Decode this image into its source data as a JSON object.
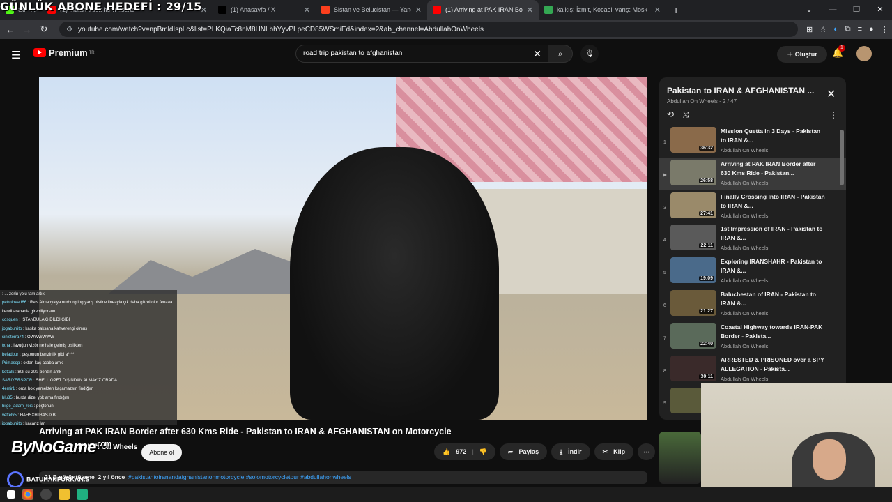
{
  "overlay": {
    "abone": "GÜNLÜK ABONE HEDEFİ : 29/15",
    "bynogame": "ByNoGame",
    "bynogame_sup": ".com",
    "batuhan": "BATUHANFURKAN.S"
  },
  "browser": {
    "tabs": [
      {
        "label": "Stream - Kick Dashboard",
        "fav": "#53fc18"
      },
      {
        "label": "(1) Indian truck horn #sorts",
        "fav": "#ff0000"
      },
      {
        "label": "(1) Anasayfa / X",
        "fav": "#000000"
      },
      {
        "label": "Sistan ve Belucistan — Yandex",
        "fav": "#fc3f1d"
      },
      {
        "label": "(1) Arriving at PAK IRAN Bo",
        "fav": "#ff0000",
        "active": true
      },
      {
        "label": "kalkış: İzmit, Kocaeli varış: Mosk",
        "fav": "#34a853"
      }
    ],
    "new_tab": "+",
    "url": "youtube.com/watch?v=npBmldIspLc&list=PLKQiaTc8nM8HNLbhYyvPLpeCD85WSmiEd&index=2&ab_channel=AbdullahOnWheels"
  },
  "yt": {
    "premium": "Premium",
    "region": "TR",
    "search_query": "road trip pakistan to afghanistan",
    "create": "Oluştur",
    "notif_count": "1"
  },
  "video": {
    "title": "Arriving at PAK IRAN Border after 630 Kms Ride - Pakistan to IRAN & AFGHANISTAN on Motorcycle",
    "channel": "Abdullah On Wheels",
    "subscribe": "Abone ol",
    "likes": "972",
    "share": "Paylaş",
    "download": "İndir",
    "clip": "Klip",
    "views": "21 B görüntüleme",
    "age": "2 yıl önce",
    "hashtags": "#pakistantoiranandafghanistanonmotorcycle #solomotorcycletour #abdullahonwheels"
  },
  "chat": [
    {
      "u": "",
      "m": "... zorlu yolu tam artık"
    },
    {
      "u": "petrolhead66",
      "m": "Reis Almanya'ya nurburgring yarış pistine lineayla çık daha güzel olur fenaaa kendi arabanla girebiliyorsun"
    },
    {
      "u": "cosquen",
      "m": "İSTANBULA GİDİLDİ GİBİ"
    },
    {
      "u": "jogaburrito",
      "m": "kaska baksana kahverengi olmuş"
    },
    {
      "u": "sinisterra74",
      "m": "OWWWWWW"
    },
    {
      "u": "txna",
      "m": "lavuğun vizör ne hale gelmiş pislikten"
    },
    {
      "u": "beladbur",
      "m": "peştonun benzinlik gibi a****"
    },
    {
      "u": "Primasop",
      "m": "oktan kaç acaba amk"
    },
    {
      "u": "kettalk",
      "m": "80li su 20si benzin amk"
    },
    {
      "u": "SARIYERSPOR",
      "m": "SHELL OPET DIŞINDAN ALMAYIZ ORADA"
    },
    {
      "u": "4emir1",
      "m": "orda bok yemekten kaçamazsın findığım"
    },
    {
      "u": "blu35",
      "m": "burda dizel yok ama findığım"
    },
    {
      "u": "bilge_adam_reis",
      "m": "peştonun"
    },
    {
      "u": "vettelv5",
      "m": "HAHSXHJBASJXB"
    },
    {
      "u": "jogaburrito",
      "m": "kaçarız lan"
    }
  ],
  "playlist": {
    "title": "Pakistan to IRAN & AFGHANISTAN ...",
    "owner": "Abdullah On Wheels",
    "position": "2 / 47",
    "items": [
      {
        "idx": "1",
        "title": "Mission Quetta in 3 Days - Pakistan to IRAN &...",
        "channel": "Abdullah On Wheels",
        "dur": "36:32",
        "c": "#8a6a4a"
      },
      {
        "idx": "▶",
        "title": "Arriving at PAK IRAN Border after 630 Kms Ride - Pakistan...",
        "channel": "Abdullah On Wheels",
        "dur": "26:58",
        "c": "#7a7a6a",
        "active": true
      },
      {
        "idx": "3",
        "title": "Finally Crossing Into IRAN - Pakistan to IRAN &...",
        "channel": "Abdullah On Wheels",
        "dur": "27:41",
        "c": "#9a8a6a"
      },
      {
        "idx": "4",
        "title": "1st Impression of IRAN - Pakistan to IRAN &...",
        "channel": "Abdullah On Wheels",
        "dur": "22:11",
        "c": "#5a5a5a"
      },
      {
        "idx": "5",
        "title": "Exploring IRANSHAHR - Pakistan to IRAN &...",
        "channel": "Abdullah On Wheels",
        "dur": "19:09",
        "c": "#4a6a8a"
      },
      {
        "idx": "6",
        "title": "Baluchestan of IRAN - Pakistan to IRAN &...",
        "channel": "Abdullah On Wheels",
        "dur": "21:27",
        "c": "#6a5a3a"
      },
      {
        "idx": "7",
        "title": "Coastal Highway towards IRAN-PAK Border - Pakista...",
        "channel": "Abdullah On Wheels",
        "dur": "22:40",
        "c": "#5a6a5a"
      },
      {
        "idx": "8",
        "title": "ARRESTED & PRISONED over a SPY ALLEGATION - Pakista...",
        "channel": "Abdullah On Wheels",
        "dur": "30:11",
        "c": "#3a2a2a"
      },
      {
        "idx": "9",
        "title": "",
        "channel": "",
        "dur": "",
        "c": "#5a5a3a"
      }
    ]
  }
}
